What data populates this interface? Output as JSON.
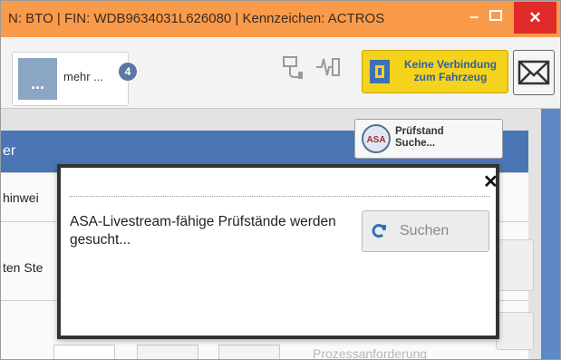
{
  "window": {
    "title": "N: BTO | FIN: WDB9634031L626080 | Kennzeichen: ACTROS",
    "minimize_icon": "minimize-icon",
    "maximize_icon": "maximize-icon",
    "close_glyph": "✕"
  },
  "toolbar": {
    "more_label": "mehr ...",
    "more_tile_glyph": "...",
    "more_badge": "4",
    "tool_icons": [
      "diagnostic-plug-icon",
      "signal-measure-icon"
    ],
    "connection": {
      "line1": "Keine Verbindung",
      "line2": "zum Fahrzeug",
      "icon": "vehicle-connection-icon",
      "color": "#f5d21b"
    },
    "mail_icon": "mail-icon"
  },
  "background": {
    "header_text": "er",
    "row1_label": "hinwei",
    "row2_label": "ten Ste",
    "bottom_text": "Prozessanforderung",
    "pruefstand_button": {
      "icon": "asa-icon",
      "icon_text": "ASA",
      "line1": "Prüfstand",
      "line2": "Suche..."
    },
    "header_color": "#4a76b5"
  },
  "dialog": {
    "close_glyph": "✕",
    "message": "ASA-Livestream-fähige Prüfstände werden gesucht...",
    "search_button_label": "Suchen",
    "search_icon": "refresh-icon"
  }
}
